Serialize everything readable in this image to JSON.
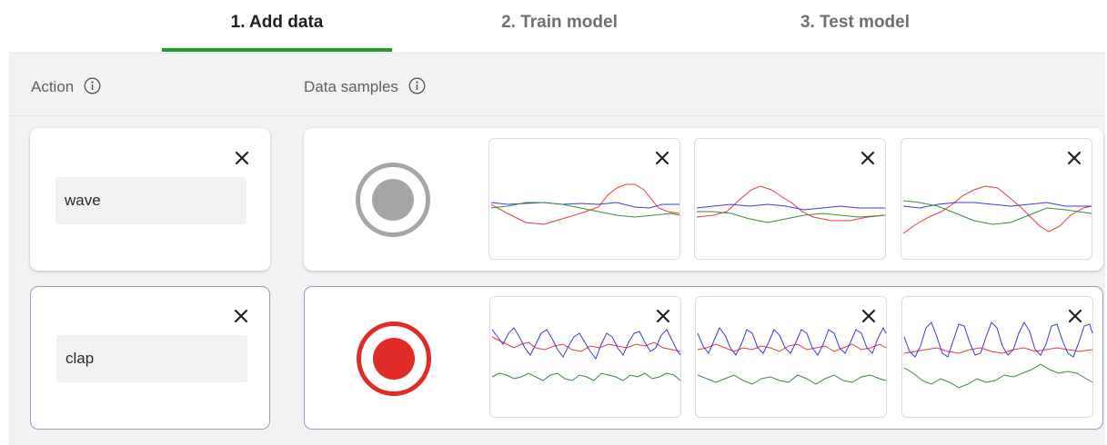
{
  "tabs": [
    {
      "label": "1. Add data",
      "active": true
    },
    {
      "label": "2. Train model",
      "active": false
    },
    {
      "label": "3. Test model",
      "active": false
    }
  ],
  "headers": {
    "action": "Action",
    "data_samples": "Data samples"
  },
  "colors": {
    "active_tab_underline": "#1e9e2a",
    "record_idle": "#a6a6a6",
    "record_active": "#e02b27",
    "series_red": "#e8383d",
    "series_blue": "#3b3bd8",
    "series_green": "#3a8a3a"
  },
  "icons": {
    "info": "info-icon",
    "close": "close-icon",
    "record": "record-icon"
  },
  "actions": [
    {
      "label": "wave",
      "selected": false,
      "recording": false,
      "sample_count": 3
    },
    {
      "label": "clap",
      "selected": true,
      "recording": true,
      "sample_count": 3
    }
  ]
}
